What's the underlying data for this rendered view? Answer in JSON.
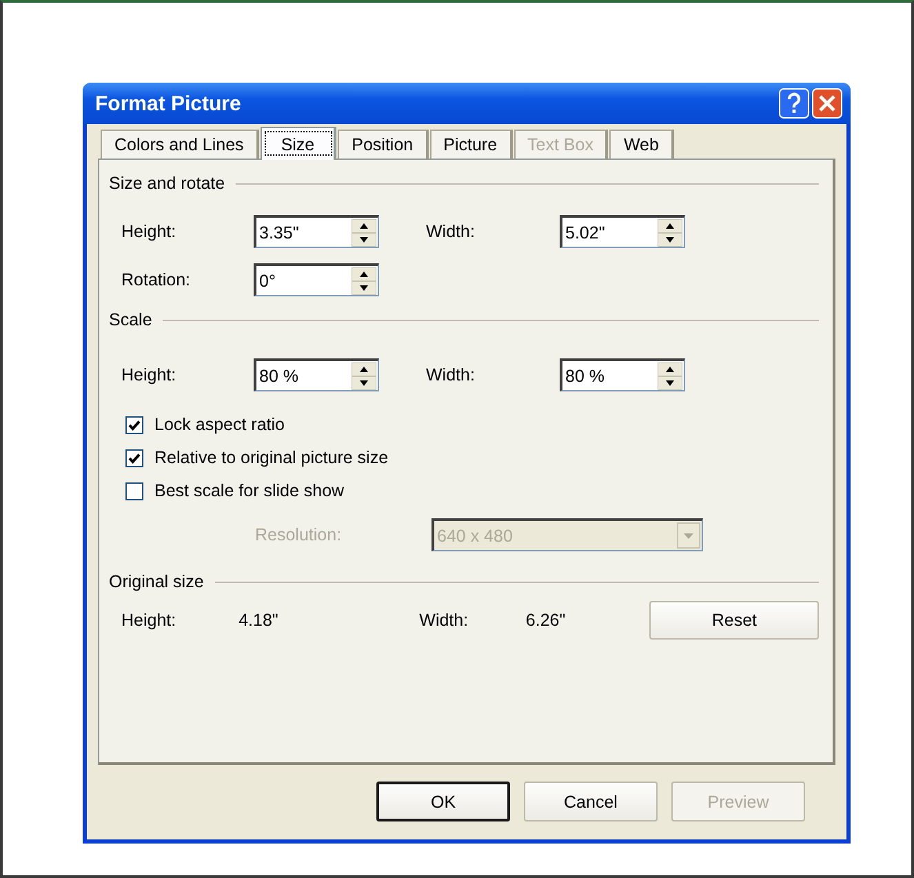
{
  "window": {
    "title": "Format Picture"
  },
  "tabs": [
    {
      "label": "Colors and Lines",
      "selected": false,
      "disabled": false
    },
    {
      "label": "Size",
      "selected": true,
      "disabled": false
    },
    {
      "label": "Position",
      "selected": false,
      "disabled": false
    },
    {
      "label": "Picture",
      "selected": false,
      "disabled": false
    },
    {
      "label": "Text Box",
      "selected": false,
      "disabled": true
    },
    {
      "label": "Web",
      "selected": false,
      "disabled": false
    }
  ],
  "size_and_rotate": {
    "title": "Size and rotate",
    "fields": [
      {
        "label": "Height:",
        "value": "3.35\""
      },
      {
        "label": "Width:",
        "value": "5.02\""
      },
      {
        "label": "Rotation:",
        "value": "0°"
      }
    ]
  },
  "scale": {
    "title": "Scale",
    "fields": [
      {
        "label": "Height:",
        "value": "80 %"
      },
      {
        "label": "Width:",
        "value": "80 %"
      }
    ],
    "checkboxes": [
      {
        "label": "Lock aspect ratio",
        "checked": true
      },
      {
        "label": "Relative to original picture size",
        "checked": true
      },
      {
        "label": "Best scale for slide show",
        "checked": false
      }
    ],
    "resolution": {
      "label": "Resolution:",
      "value": "640 x 480",
      "disabled": true
    }
  },
  "original_size": {
    "title": "Original size",
    "height_label": "Height:",
    "height": "4.18\"",
    "width_label": "Width:",
    "width": "6.26\"",
    "reset_button": "Reset"
  },
  "buttons": [
    {
      "label": "OK",
      "disabled": false,
      "default": true
    },
    {
      "label": "Cancel",
      "disabled": false,
      "default": false
    },
    {
      "label": "Preview",
      "disabled": true,
      "default": false
    }
  ]
}
